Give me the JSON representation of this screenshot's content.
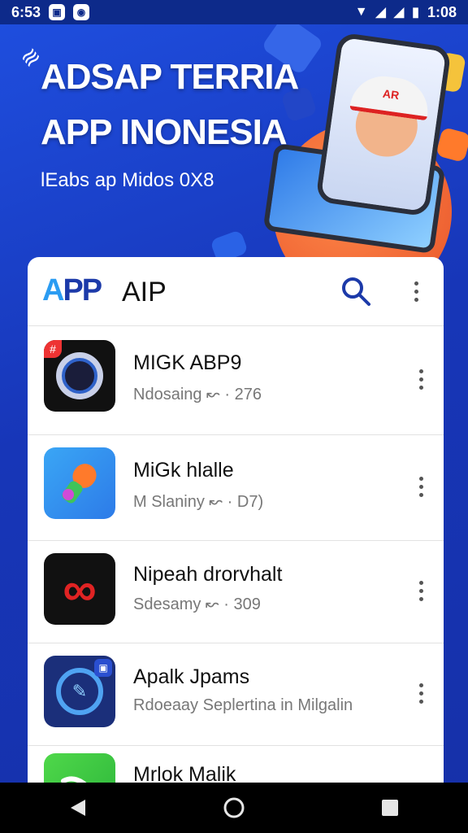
{
  "status_bar": {
    "left_time": "6:53",
    "right_time": "1:08"
  },
  "hero": {
    "title_line1": "ADSAP TERRIA",
    "title_line2": "APP INONESIA",
    "subtitle": "lEabs ap Midos 0X8",
    "phone_cap_text": "AR"
  },
  "header": {
    "brand_a": "A",
    "brand_pp": "PP",
    "title": "AIP"
  },
  "apps": [
    {
      "name": "MIGK ABP9",
      "subtitle": "Ndosaing ↜ · 276",
      "icon": "camera-lens-icon"
    },
    {
      "name": "MiGk hlalle",
      "subtitle": "M Slaniny ↜ · D7)",
      "icon": "microphone-app-icon"
    },
    {
      "name": "Nipeah drorvhalt",
      "subtitle": "Sdesamy ↜ · 309",
      "icon": "infinity-app-icon"
    },
    {
      "name": "Apalk Jpams",
      "subtitle": "Rdoeaay Seplertina in Milgalin",
      "icon": "compass-app-icon"
    },
    {
      "name": "Mrlok Malik",
      "subtitle": "",
      "icon": "green-app-icon"
    }
  ],
  "colors": {
    "hero_bg": "#1f4fe0",
    "accent": "#1c3aa9",
    "brand_light": "#2b9cf2"
  }
}
